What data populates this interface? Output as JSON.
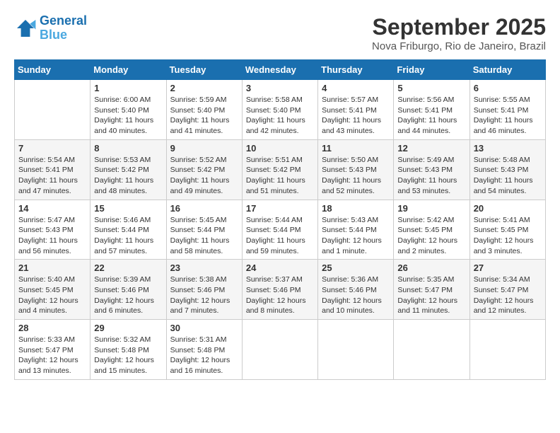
{
  "header": {
    "logo_line1": "General",
    "logo_line2": "Blue",
    "month": "September 2025",
    "location": "Nova Friburgo, Rio de Janeiro, Brazil"
  },
  "weekdays": [
    "Sunday",
    "Monday",
    "Tuesday",
    "Wednesday",
    "Thursday",
    "Friday",
    "Saturday"
  ],
  "weeks": [
    [
      {
        "day": "",
        "sunrise": "",
        "sunset": "",
        "daylight": ""
      },
      {
        "day": "1",
        "sunrise": "6:00 AM",
        "sunset": "5:40 PM",
        "daylight": "11 hours and 40 minutes."
      },
      {
        "day": "2",
        "sunrise": "5:59 AM",
        "sunset": "5:40 PM",
        "daylight": "11 hours and 41 minutes."
      },
      {
        "day": "3",
        "sunrise": "5:58 AM",
        "sunset": "5:40 PM",
        "daylight": "11 hours and 42 minutes."
      },
      {
        "day": "4",
        "sunrise": "5:57 AM",
        "sunset": "5:41 PM",
        "daylight": "11 hours and 43 minutes."
      },
      {
        "day": "5",
        "sunrise": "5:56 AM",
        "sunset": "5:41 PM",
        "daylight": "11 hours and 44 minutes."
      },
      {
        "day": "6",
        "sunrise": "5:55 AM",
        "sunset": "5:41 PM",
        "daylight": "11 hours and 46 minutes."
      }
    ],
    [
      {
        "day": "7",
        "sunrise": "5:54 AM",
        "sunset": "5:41 PM",
        "daylight": "11 hours and 47 minutes."
      },
      {
        "day": "8",
        "sunrise": "5:53 AM",
        "sunset": "5:42 PM",
        "daylight": "11 hours and 48 minutes."
      },
      {
        "day": "9",
        "sunrise": "5:52 AM",
        "sunset": "5:42 PM",
        "daylight": "11 hours and 49 minutes."
      },
      {
        "day": "10",
        "sunrise": "5:51 AM",
        "sunset": "5:42 PM",
        "daylight": "11 hours and 51 minutes."
      },
      {
        "day": "11",
        "sunrise": "5:50 AM",
        "sunset": "5:43 PM",
        "daylight": "11 hours and 52 minutes."
      },
      {
        "day": "12",
        "sunrise": "5:49 AM",
        "sunset": "5:43 PM",
        "daylight": "11 hours and 53 minutes."
      },
      {
        "day": "13",
        "sunrise": "5:48 AM",
        "sunset": "5:43 PM",
        "daylight": "11 hours and 54 minutes."
      }
    ],
    [
      {
        "day": "14",
        "sunrise": "5:47 AM",
        "sunset": "5:43 PM",
        "daylight": "11 hours and 56 minutes."
      },
      {
        "day": "15",
        "sunrise": "5:46 AM",
        "sunset": "5:44 PM",
        "daylight": "11 hours and 57 minutes."
      },
      {
        "day": "16",
        "sunrise": "5:45 AM",
        "sunset": "5:44 PM",
        "daylight": "11 hours and 58 minutes."
      },
      {
        "day": "17",
        "sunrise": "5:44 AM",
        "sunset": "5:44 PM",
        "daylight": "11 hours and 59 minutes."
      },
      {
        "day": "18",
        "sunrise": "5:43 AM",
        "sunset": "5:44 PM",
        "daylight": "12 hours and 1 minute."
      },
      {
        "day": "19",
        "sunrise": "5:42 AM",
        "sunset": "5:45 PM",
        "daylight": "12 hours and 2 minutes."
      },
      {
        "day": "20",
        "sunrise": "5:41 AM",
        "sunset": "5:45 PM",
        "daylight": "12 hours and 3 minutes."
      }
    ],
    [
      {
        "day": "21",
        "sunrise": "5:40 AM",
        "sunset": "5:45 PM",
        "daylight": "12 hours and 4 minutes."
      },
      {
        "day": "22",
        "sunrise": "5:39 AM",
        "sunset": "5:46 PM",
        "daylight": "12 hours and 6 minutes."
      },
      {
        "day": "23",
        "sunrise": "5:38 AM",
        "sunset": "5:46 PM",
        "daylight": "12 hours and 7 minutes."
      },
      {
        "day": "24",
        "sunrise": "5:37 AM",
        "sunset": "5:46 PM",
        "daylight": "12 hours and 8 minutes."
      },
      {
        "day": "25",
        "sunrise": "5:36 AM",
        "sunset": "5:46 PM",
        "daylight": "12 hours and 10 minutes."
      },
      {
        "day": "26",
        "sunrise": "5:35 AM",
        "sunset": "5:47 PM",
        "daylight": "12 hours and 11 minutes."
      },
      {
        "day": "27",
        "sunrise": "5:34 AM",
        "sunset": "5:47 PM",
        "daylight": "12 hours and 12 minutes."
      }
    ],
    [
      {
        "day": "28",
        "sunrise": "5:33 AM",
        "sunset": "5:47 PM",
        "daylight": "12 hours and 13 minutes."
      },
      {
        "day": "29",
        "sunrise": "5:32 AM",
        "sunset": "5:48 PM",
        "daylight": "12 hours and 15 minutes."
      },
      {
        "day": "30",
        "sunrise": "5:31 AM",
        "sunset": "5:48 PM",
        "daylight": "12 hours and 16 minutes."
      },
      {
        "day": "",
        "sunrise": "",
        "sunset": "",
        "daylight": ""
      },
      {
        "day": "",
        "sunrise": "",
        "sunset": "",
        "daylight": ""
      },
      {
        "day": "",
        "sunrise": "",
        "sunset": "",
        "daylight": ""
      },
      {
        "day": "",
        "sunrise": "",
        "sunset": "",
        "daylight": ""
      }
    ]
  ]
}
